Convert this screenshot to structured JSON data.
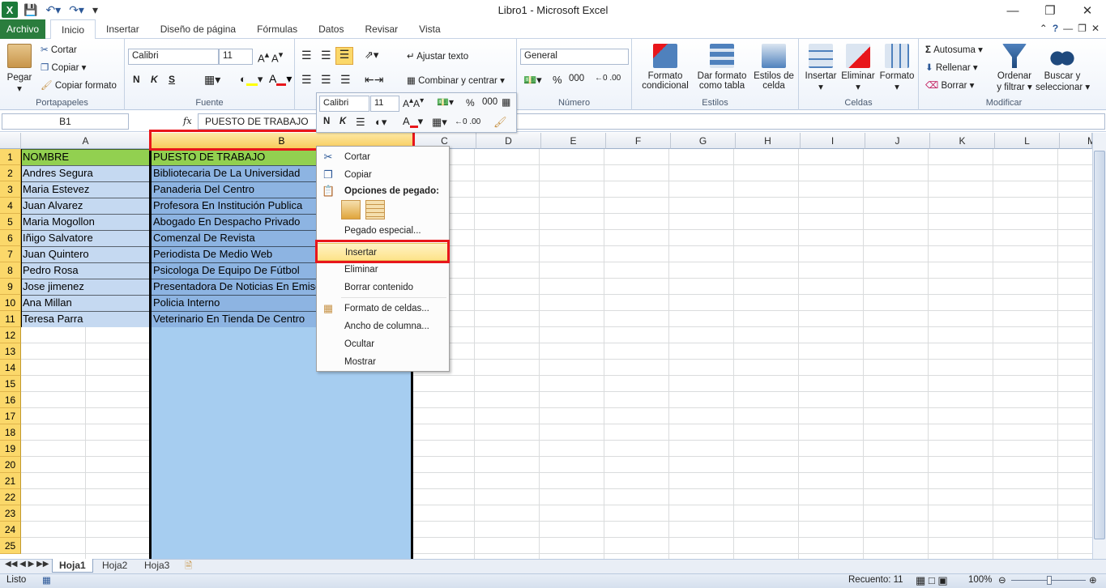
{
  "window": {
    "title": "Libro1  -  Microsoft Excel"
  },
  "qat": {
    "undo_icon": "undo-icon",
    "redo_icon": "redo-icon",
    "save_icon": "save-icon"
  },
  "tabs": {
    "file": "Archivo",
    "items": [
      "Inicio",
      "Insertar",
      "Diseño de página",
      "Fórmulas",
      "Datos",
      "Revisar",
      "Vista"
    ]
  },
  "ribbon": {
    "clipboard": {
      "label": "Portapapeles",
      "paste": "Pegar",
      "cut": "Cortar",
      "copy": "Copiar",
      "format_painter": "Copiar formato"
    },
    "font": {
      "label": "Fuente",
      "name": "Calibri",
      "size": "11",
      "bold": "N",
      "italic": "K",
      "underline": "S"
    },
    "alignment": {
      "wrap": "Ajustar texto",
      "merge": "Combinar y centrar"
    },
    "number": {
      "label": "Número",
      "format": "General",
      "percent": "%",
      "thousands": "000"
    },
    "styles": {
      "label": "Estilos",
      "conditional1": "Formato",
      "conditional2": "condicional",
      "table1": "Dar formato",
      "table2": "como tabla",
      "cell1": "Estilos de",
      "cell2": "celda"
    },
    "cells": {
      "label": "Celdas",
      "insert": "Insertar",
      "delete": "Eliminar",
      "format": "Formato"
    },
    "editing": {
      "label": "Modificar",
      "autosum": "Autosuma",
      "fill": "Rellenar",
      "clear": "Borrar",
      "sort1": "Ordenar",
      "sort2": "y filtrar",
      "find1": "Buscar y",
      "find2": "seleccionar"
    }
  },
  "formula_bar": {
    "namebox": "B1",
    "fx": "fx",
    "content": "PUESTO DE TRABAJO"
  },
  "columns": [
    "A",
    "B",
    "C",
    "D",
    "E",
    "F",
    "G",
    "H",
    "I",
    "J",
    "K",
    "L",
    "M"
  ],
  "rows": [
    "1",
    "2",
    "3",
    "4",
    "5",
    "6",
    "7",
    "8",
    "9",
    "10",
    "11",
    "12",
    "13",
    "14",
    "15",
    "16",
    "17",
    "18",
    "19",
    "20",
    "21",
    "22",
    "23",
    "24",
    "25"
  ],
  "cells_a": [
    "NOMBRE",
    "Andres Segura",
    "Maria Estevez",
    "Juan Alvarez",
    "Maria Mogollon",
    "Iñigo Salvatore",
    "Juan Quintero",
    "Pedro Rosa",
    "Jose jimenez",
    "Ana Millan",
    "Teresa Parra"
  ],
  "cells_b": [
    "PUESTO DE TRABAJO",
    "Bibliotecaria De La Universidad",
    "Panaderia Del Centro",
    "Profesora En Institución Publica",
    "Abogado En Despacho Privado",
    "Comenzal De Revista",
    "Periodista De Medio Web",
    "Psicologa De Equipo De Fútbol",
    "Presentadora De Noticias En Emisora",
    "Policia Interno",
    "Veterinario En Tienda De Centro"
  ],
  "context_menu": {
    "cut": "Cortar",
    "copy": "Copiar",
    "paste_options": "Opciones de pegado:",
    "paste_special": "Pegado especial...",
    "insert": "Insertar",
    "delete": "Eliminar",
    "clear": "Borrar contenido",
    "format_cells": "Formato de celdas...",
    "col_width": "Ancho de columna...",
    "hide": "Ocultar",
    "show": "Mostrar"
  },
  "mini_toolbar": {
    "font": "Calibri",
    "size": "11",
    "bold": "N",
    "italic": "K",
    "percent": "%",
    "thousands": "000"
  },
  "sheets": [
    "Hoja1",
    "Hoja2",
    "Hoja3"
  ],
  "status": {
    "ready": "Listo",
    "count": "Recuento: 11",
    "zoom": "100%"
  },
  "colors": {
    "header_green": "#92d050",
    "name_blue": "#c5d9f1",
    "job_blue": "#8db4e2",
    "selection": "#a6cdf0",
    "highlight": "#e8161b"
  }
}
